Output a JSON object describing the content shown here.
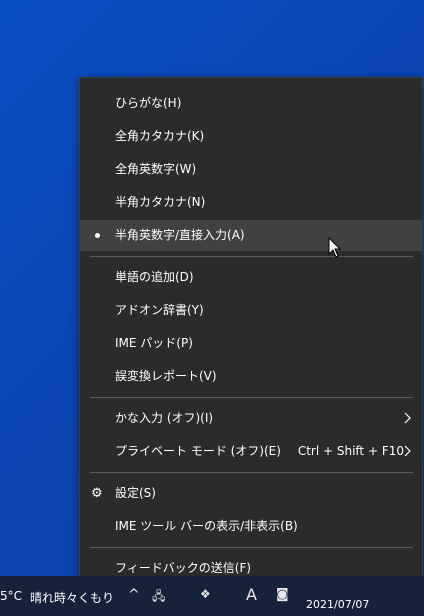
{
  "menu": {
    "items": [
      {
        "label": "ひらがな(H)"
      },
      {
        "label": "全角カタカナ(K)"
      },
      {
        "label": "全角英数字(W)"
      },
      {
        "label": "半角カタカナ(N)"
      },
      {
        "label": "半角英数字/直接入力(A)",
        "selected": true
      },
      {
        "label": "単語の追加(D)"
      },
      {
        "label": "アドオン辞書(Y)"
      },
      {
        "label": "IME パッド(P)"
      },
      {
        "label": "誤変換レポート(V)"
      },
      {
        "label": "かな入力 (オフ)(I)"
      },
      {
        "label": "プライベート モード (オフ)(E)",
        "shortcut": "Ctrl + Shift + F10"
      },
      {
        "label": "設定(S)",
        "icon": "gear-icon"
      },
      {
        "label": "IME ツール バーの表示/非表示(B)"
      },
      {
        "label": "フィードバックの送信(F)"
      }
    ]
  },
  "taskbar": {
    "temperature": "5°C",
    "weather": "晴れ時々くもり",
    "date": "2021/07/07",
    "ime_indicator": "A"
  }
}
